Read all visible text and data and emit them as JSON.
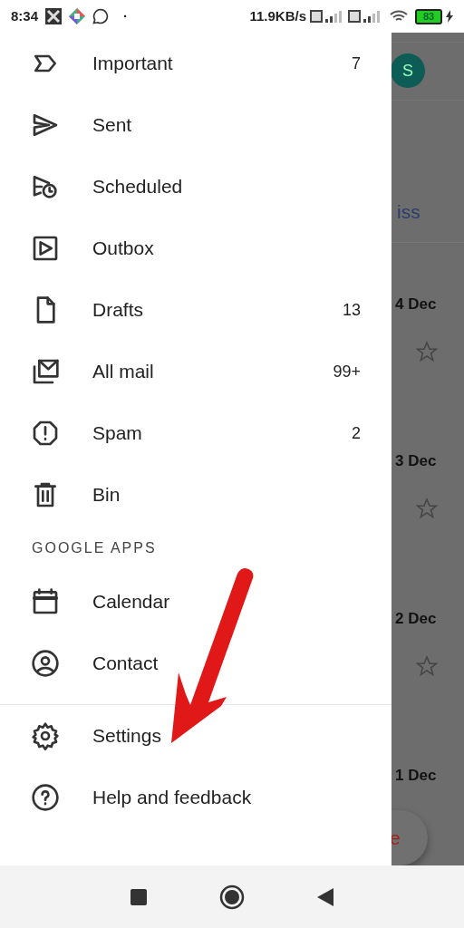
{
  "status_bar": {
    "time": "8:34",
    "dot": "·",
    "speed": "11.9KB/s",
    "battery": "83"
  },
  "drawer": {
    "items": [
      {
        "kind": "important",
        "label": "Important",
        "count": "7"
      },
      {
        "kind": "sent",
        "label": "Sent"
      },
      {
        "kind": "scheduled",
        "label": "Scheduled"
      },
      {
        "kind": "outbox",
        "label": "Outbox"
      },
      {
        "kind": "drafts",
        "label": "Drafts",
        "count": "13"
      },
      {
        "kind": "allmail",
        "label": "All mail",
        "count": "99+"
      },
      {
        "kind": "spam",
        "label": "Spam",
        "count": "2"
      },
      {
        "kind": "bin",
        "label": "Bin"
      }
    ],
    "section_header": "GOOGLE APPS",
    "apps": [
      {
        "kind": "calendar",
        "label": "Calendar"
      },
      {
        "kind": "contacts",
        "label": "Contact"
      }
    ],
    "footer": [
      {
        "kind": "settings",
        "label": "Settings"
      },
      {
        "kind": "help",
        "label": "Help and feedback"
      }
    ]
  },
  "background": {
    "avatar": "S",
    "banner_text": "iss",
    "dates": [
      "4 Dec",
      "3 Dec",
      "2 Dec",
      "1 Dec"
    ],
    "fab_text": "e"
  }
}
